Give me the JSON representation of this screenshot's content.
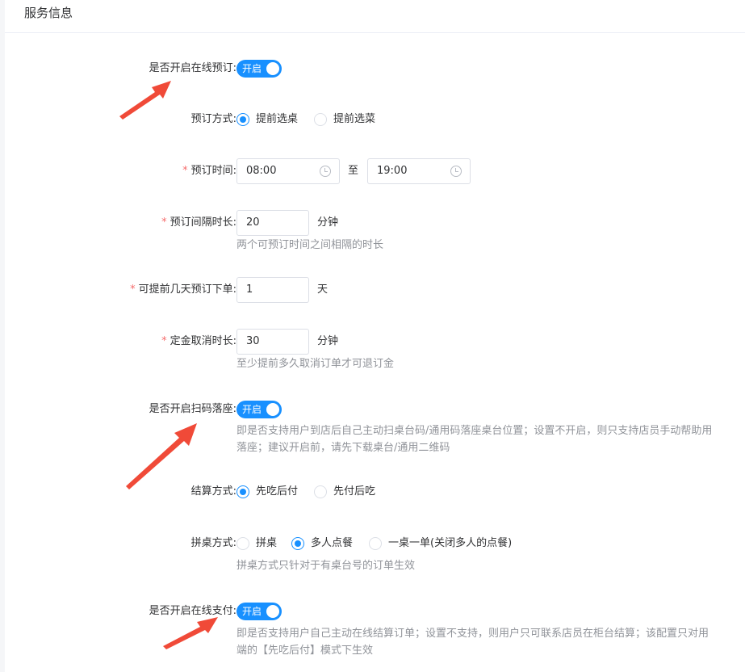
{
  "section": {
    "title": "服务信息"
  },
  "online_booking": {
    "label": "是否开启在线预订:",
    "switch_text": "开启",
    "enabled": true
  },
  "booking_mode": {
    "label": "预订方式:",
    "options": [
      {
        "label": "提前选桌",
        "checked": true
      },
      {
        "label": "提前选菜",
        "checked": false
      }
    ]
  },
  "booking_time": {
    "required_mark": "*",
    "label": "预订时间:",
    "start": "08:00",
    "separator": "至",
    "end": "19:00"
  },
  "booking_interval": {
    "required_mark": "*",
    "label": "预订间隔时长:",
    "value": "20",
    "unit": "分钟",
    "help": "两个可预订时间之间相隔的时长"
  },
  "advance_days": {
    "required_mark": "*",
    "label": "可提前几天预订下单:",
    "value": "1",
    "unit": "天"
  },
  "deposit_cancel": {
    "required_mark": "*",
    "label": "定金取消时长:",
    "value": "30",
    "unit": "分钟",
    "help": "至少提前多久取消订单才可退订金"
  },
  "scan_seat": {
    "label": "是否开启扫码落座:",
    "switch_text": "开启",
    "enabled": true,
    "help_line1": "即是否支持用户到店后自己主动扫桌台码/通用码落座桌台位置；设置不开启，则只支持店员手动帮助用",
    "help_line2": "落座；建议开启前，请先下载桌台/通用二维码"
  },
  "settlement": {
    "label": "结算方式:",
    "options": [
      {
        "label": "先吃后付",
        "checked": true
      },
      {
        "label": "先付后吃",
        "checked": false
      }
    ]
  },
  "table_share": {
    "label": "拼桌方式:",
    "options": [
      {
        "label": "拼桌",
        "checked": false
      },
      {
        "label": "多人点餐",
        "checked": true
      },
      {
        "label": "一桌一单(关闭多人的点餐)",
        "checked": false
      }
    ],
    "help": "拼桌方式只针对于有桌台号的订单生效"
  },
  "online_pay": {
    "label": "是否开启在线支付:",
    "switch_text": "开启",
    "enabled": true,
    "help_line1": "即是否支持用户自己主动在线结算订单；设置不支持，则用户只可联系店员在柜台结算；该配置只对用",
    "help_line2": "端的【先吃后付】模式下生效"
  },
  "colors": {
    "primary": "#1890ff",
    "required": "#f56c6c",
    "arrow": "#f04a38",
    "help_text": "#909399"
  },
  "icons": {
    "time_input": "clock-icon",
    "annotation": "red-arrow-icon"
  }
}
